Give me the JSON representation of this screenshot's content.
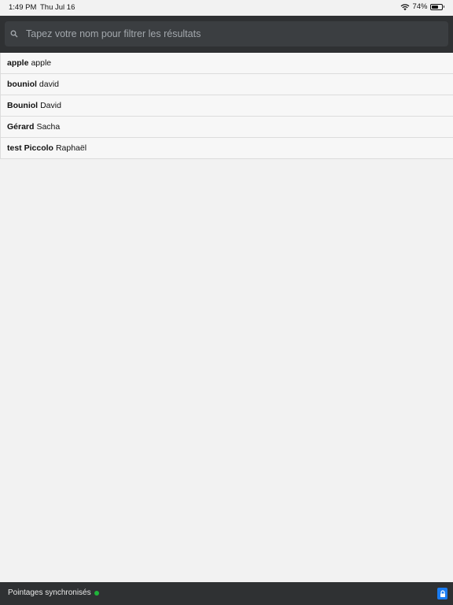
{
  "status_bar": {
    "time": "1:49 PM",
    "date": "Thu Jul 16",
    "battery": "74%",
    "battery_level": 0.74
  },
  "search": {
    "placeholder": "Tapez votre nom pour filtrer les résultats",
    "value": ""
  },
  "list": {
    "items": [
      {
        "last": "apple",
        "first": "apple"
      },
      {
        "last": "bouniol",
        "first": "david"
      },
      {
        "last": "Bouniol",
        "first": "David"
      },
      {
        "last": "Gérard",
        "first": "Sacha"
      },
      {
        "last": "test Piccolo",
        "first": "Raphaël"
      }
    ]
  },
  "footer": {
    "status_text": "Pointages synchronisés",
    "status_color": "#1fb53a",
    "lock_color": "#1a7cf2"
  }
}
